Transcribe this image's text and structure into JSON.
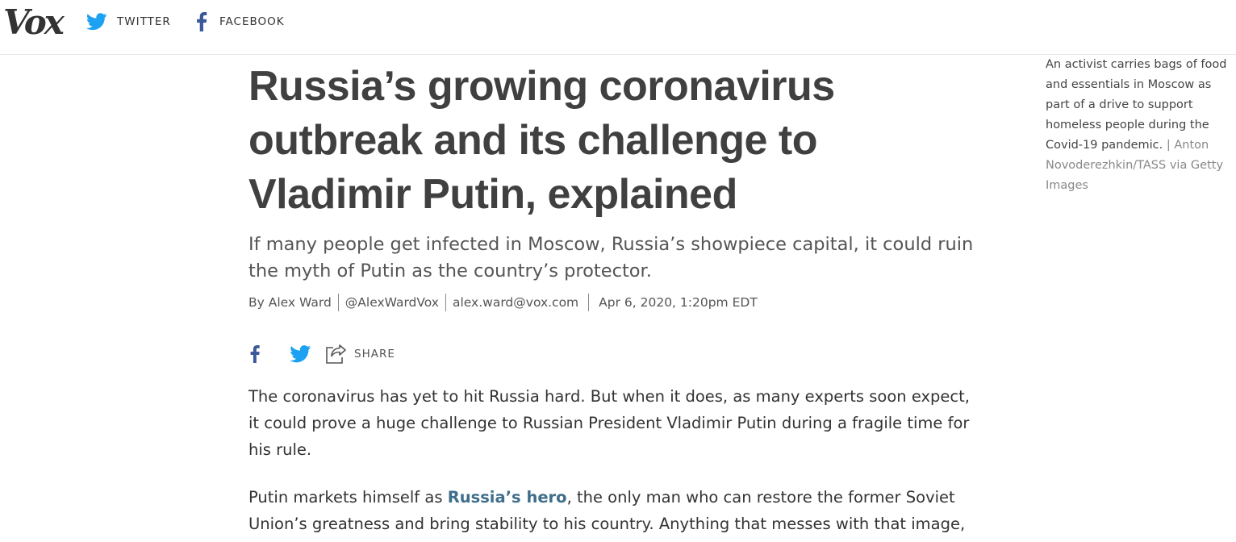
{
  "header": {
    "logo": "Vox",
    "twitter_label": "TWITTER",
    "facebook_label": "FACEBOOK"
  },
  "article": {
    "headline": "Russia’s growing coronavirus outbreak and its challenge to Vladimir Putin, explained",
    "dek": "If many people get infected in Moscow, Russia’s showpiece capital, it could ruin the myth of Putin as the country’s protector.",
    "byline": {
      "author": "By Alex Ward",
      "handle": "@AlexWardVox",
      "email": "alex.ward@vox.com",
      "date": "Apr 6, 2020, 1:20pm EDT"
    },
    "share_label": "SHARE",
    "paragraph1": "The coronavirus has yet to hit Russia hard. But when it does, as many experts soon expect, it could prove a huge challenge to Russian President Vladimir Putin during a fragile time for his rule.",
    "paragraph2_start": "Putin markets himself as ",
    "paragraph2_link": "Russia’s hero",
    "paragraph2_end": ", the only man who can restore the former Soviet Union’s greatness and bring stability to his country. Anything that messes with that image,"
  },
  "caption": {
    "text": "An activist carries bags of food and essentials in Moscow as part of a drive to support homeless people during the Covid-19 pandemic.",
    "separator": "|",
    "credit": "Anton Novoderezhkin/TASS via Getty Images"
  },
  "colors": {
    "twitter": "#1da1f2",
    "facebook": "#3b5998",
    "link": "#3f6e8a"
  }
}
